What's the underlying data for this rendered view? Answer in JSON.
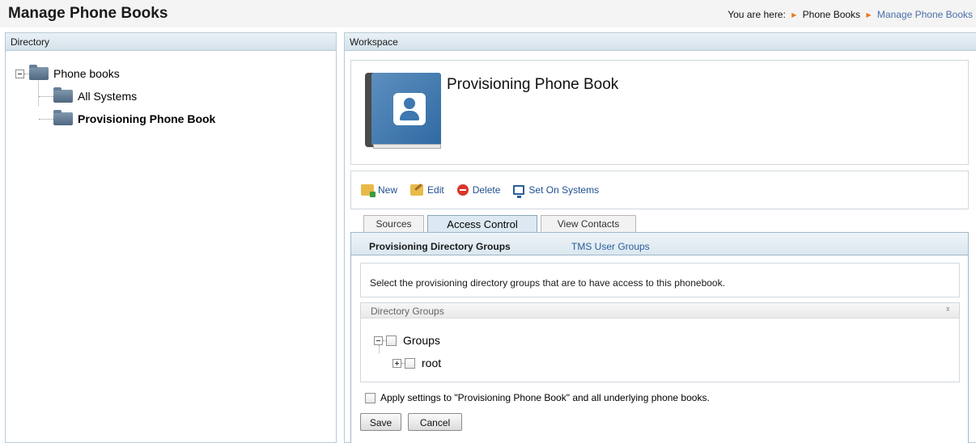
{
  "header": {
    "title": "Manage Phone Books",
    "breadcrumb_prefix": "You are here:",
    "breadcrumb": [
      "Phone Books",
      "Manage Phone Books"
    ]
  },
  "directory": {
    "title": "Directory",
    "tree": {
      "root": "Phone books",
      "children": [
        "All Systems",
        "Provisioning Phone Book"
      ]
    }
  },
  "workspace": {
    "title": "Workspace",
    "phonebook_name": "Provisioning Phone Book",
    "toolbar": {
      "new": "New",
      "edit": "Edit",
      "delete": "Delete",
      "set_on_systems": "Set On Systems"
    },
    "tabs": [
      "Sources",
      "Access Control",
      "View Contacts"
    ],
    "active_tab": "Access Control",
    "subtabs": [
      "Provisioning Directory Groups",
      "TMS User Groups"
    ],
    "description": "Select the provisioning directory groups that are to have access to this phonebook.",
    "directory_groups": {
      "title": "Directory Groups",
      "tree_root": "Groups",
      "tree_child": "root"
    },
    "apply_label": "Apply settings to \"Provisioning Phone Book\" and all underlying phone books.",
    "save": "Save",
    "cancel": "Cancel"
  },
  "colors": {
    "link": "#2a5d9b",
    "panel_border": "#b6cad8",
    "breadcrumb_arrow": "#e87a1c"
  }
}
